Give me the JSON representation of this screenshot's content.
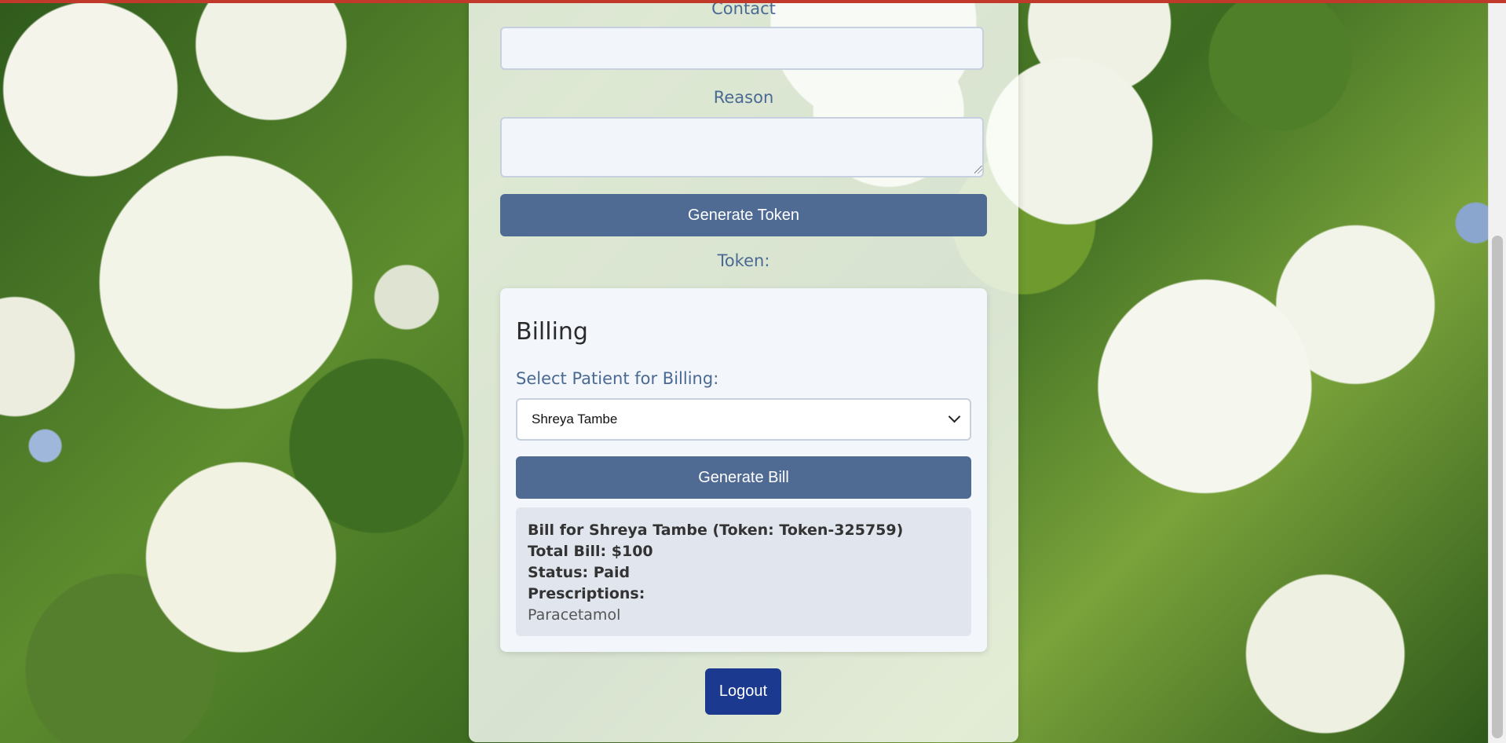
{
  "form": {
    "contact_label": "Contact",
    "contact_value": "",
    "reason_label": "Reason",
    "reason_value": "",
    "generate_token_label": "Generate Token",
    "token_label": "Token:"
  },
  "billing": {
    "title": "Billing",
    "select_label": "Select Patient for Billing:",
    "selected_patient": "Shreya Tambe",
    "generate_bill_label": "Generate Bill",
    "bill": {
      "header": "Bill for Shreya Tambe (Token: Token-325759)",
      "total": "Total Bill: $100",
      "status": "Status: Paid",
      "prescriptions_label": "Prescriptions:",
      "prescriptions": "Paracetamol"
    }
  },
  "logout_label": "Logout",
  "colors": {
    "accent": "#4f6a93",
    "label": "#4a6a94",
    "logout": "#1b3a8f",
    "top_bar": "#c0392b"
  },
  "icons": {
    "select_chevron": "chevron-down-icon",
    "textarea_resize": "resize-grip-icon"
  }
}
